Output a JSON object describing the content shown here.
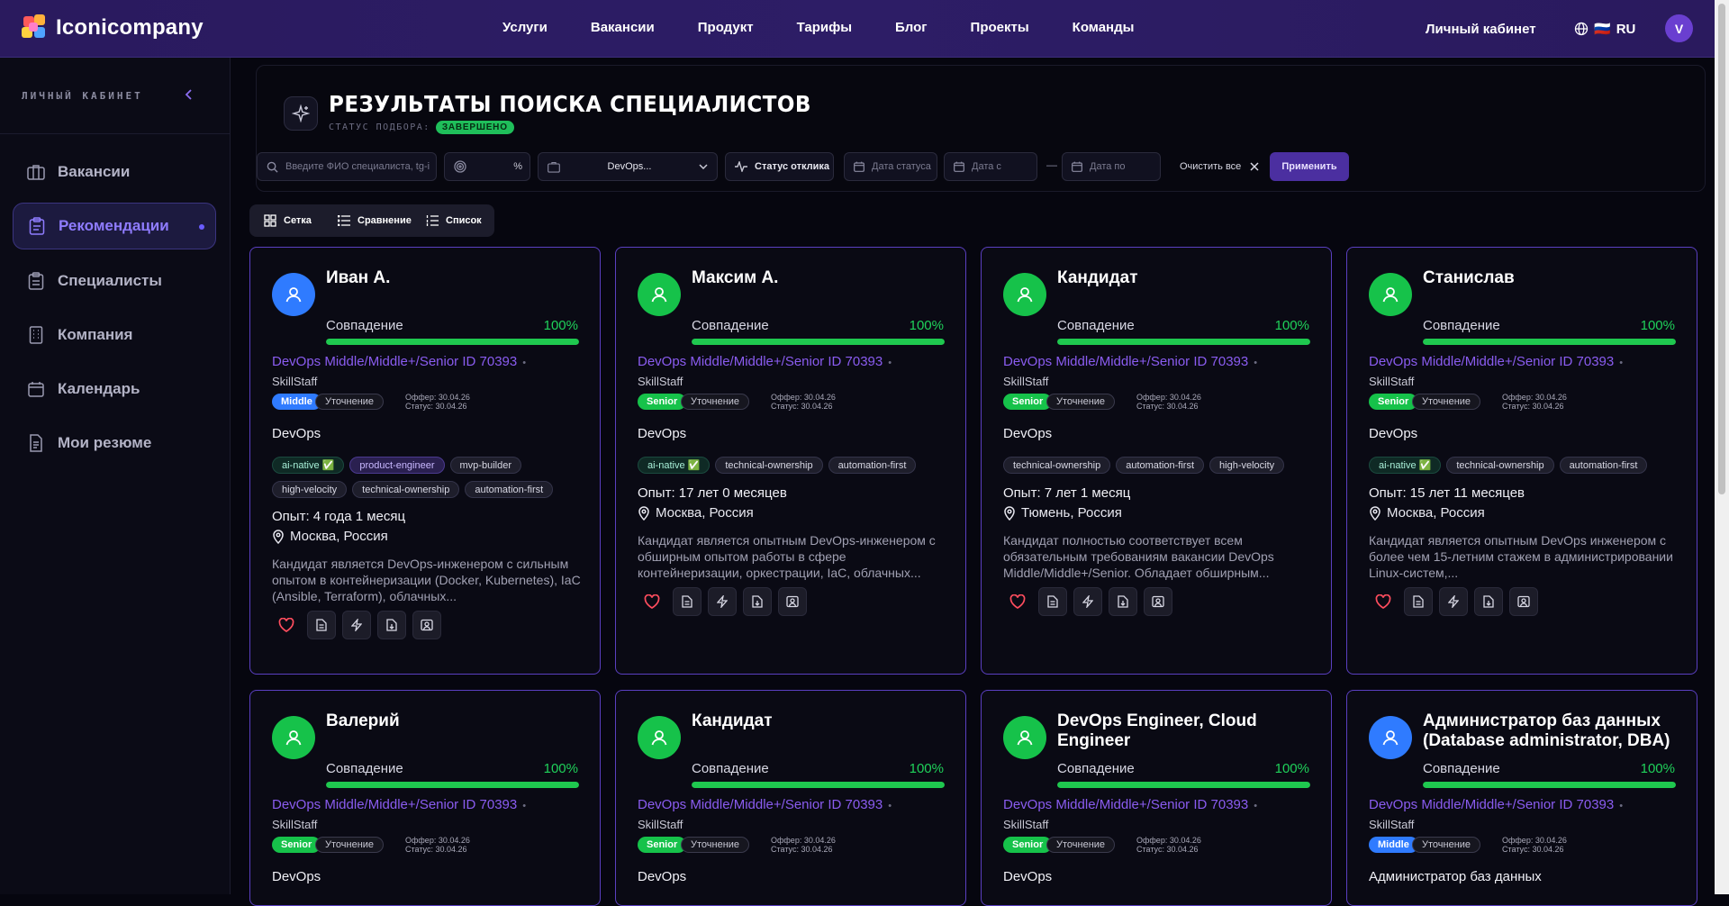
{
  "app": {
    "name": "Iconicompany"
  },
  "nav": [
    "Услуги",
    "Вакансии",
    "Продукт",
    "Тарифы",
    "Блог",
    "Проекты",
    "Команды"
  ],
  "header": {
    "cabinet": "Личный кабинет",
    "lang": "RU",
    "flag": "🇷🇺",
    "avatar_letter": "V"
  },
  "sidebar": {
    "title": "ЛИЧНЫЙ КАБИНЕТ",
    "items": [
      {
        "label": "Вакансии",
        "icon": "briefcase-icon"
      },
      {
        "label": "Рекомендации",
        "icon": "clipboard-icon",
        "active": true
      },
      {
        "label": "Специалисты",
        "icon": "clipboard-list-icon"
      },
      {
        "label": "Компания",
        "icon": "building-icon"
      },
      {
        "label": "Календарь",
        "icon": "calendar-icon"
      },
      {
        "label": "Мои резюме",
        "icon": "document-icon"
      }
    ]
  },
  "page": {
    "title": "РЕЗУЛЬТАТЫ ПОИСКА СПЕЦИАЛИСТОВ",
    "status_label": "СТАТУС ПОДБОРА:",
    "status_value": "ЗАВЕРШЕНО"
  },
  "filters": {
    "search_placeholder": "Введите ФИО специалиста, tg-i",
    "percent_symbol": "%",
    "vacancy_value": "DevOps...",
    "response_status": "Статус отклика",
    "status_date_placeholder": "Дата статуса",
    "date_from_placeholder": "Дата с",
    "dash": "—",
    "date_to_placeholder": "Дата по",
    "clear_all": "Очистить все",
    "apply": "Применить"
  },
  "view_switch": {
    "grid": "Сетка",
    "compare": "Сравнение",
    "list": "Список"
  },
  "colors": {
    "accent": "#8a5cf0",
    "green": "#1fc84f",
    "blue_avatar": "#2f7bff",
    "green_avatar": "#16c24a",
    "middle_badge": "#2f7bff",
    "senior_badge": "#16c24a"
  },
  "card_labels": {
    "match": "Совпадение",
    "clarify": "Уточнение"
  },
  "cards": [
    {
      "name": "Иван А.",
      "avatar_color": "blue",
      "match": "100%",
      "match_fraction": 1.0,
      "vacancy": "DevOps Middle/Middle+/Senior ID 70393",
      "company": "SkillStaff",
      "level": "Middle",
      "offer": "Оффер: 30.04.26",
      "status": "Статус: 30.04.26",
      "role": "DevOps",
      "tags": [
        {
          "label": "ai-native ✅",
          "kind": "ai"
        },
        {
          "label": "product-engineer",
          "kind": "pe"
        },
        {
          "label": "mvp-builder",
          "kind": "plain"
        },
        {
          "label": "high-velocity",
          "kind": "plain"
        },
        {
          "label": "technical-ownership",
          "kind": "plain"
        },
        {
          "label": "automation-first",
          "kind": "plain"
        }
      ],
      "experience": "Опыт: 4 года 1 месяц",
      "location": "Москва, Россия",
      "description": "Кандидат является DevOps-инженером с сильным опытом в контейнеризации (Docker, Kubernetes), IaC (Ansible, Terraform), облачных..."
    },
    {
      "name": "Максим А.",
      "avatar_color": "green",
      "match": "100%",
      "match_fraction": 1.0,
      "vacancy": "DevOps Middle/Middle+/Senior ID 70393",
      "company": "SkillStaff",
      "level": "Senior",
      "offer": "Оффер: 30.04.26",
      "status": "Статус: 30.04.26",
      "role": "DevOps",
      "tags": [
        {
          "label": "ai-native ✅",
          "kind": "ai"
        },
        {
          "label": "technical-ownership",
          "kind": "plain"
        },
        {
          "label": "automation-first",
          "kind": "plain"
        }
      ],
      "experience": "Опыт: 17 лет 0 месяцев",
      "location": "Москва, Россия",
      "description": "Кандидат является опытным DevOps-инженером с обширным опытом работы в сфере контейнеризации, оркестрации, IaC, облачных..."
    },
    {
      "name": "Кандидат",
      "avatar_color": "green",
      "match": "100%",
      "match_fraction": 1.0,
      "vacancy": "DevOps Middle/Middle+/Senior ID 70393",
      "company": "SkillStaff",
      "level": "Senior",
      "offer": "Оффер: 30.04.26",
      "status": "Статус: 30.04.26",
      "role": "DevOps",
      "tags": [
        {
          "label": "technical-ownership",
          "kind": "plain"
        },
        {
          "label": "automation-first",
          "kind": "plain"
        },
        {
          "label": "high-velocity",
          "kind": "plain"
        }
      ],
      "experience": "Опыт: 7 лет 1 месяц",
      "location": "Тюмень, Россия",
      "description": "Кандидат полностью соответствует всем обязательным требованиям вакансии DevOps Middle/Middle+/Senior. Обладает обширным..."
    },
    {
      "name": "Станислав",
      "avatar_color": "green",
      "match": "100%",
      "match_fraction": 1.0,
      "vacancy": "DevOps Middle/Middle+/Senior ID 70393",
      "company": "SkillStaff",
      "level": "Senior",
      "offer": "Оффер: 30.04.26",
      "status": "Статус: 30.04.26",
      "role": "DevOps",
      "tags": [
        {
          "label": "ai-native ✅",
          "kind": "ai"
        },
        {
          "label": "technical-ownership",
          "kind": "plain"
        },
        {
          "label": "automation-first",
          "kind": "plain"
        }
      ],
      "experience": "Опыт: 15 лет 11 месяцев",
      "location": "Москва, Россия",
      "description": "Кандидат является опытным DevOps инженером с более чем 15-летним стажем в администрировании Linux-систем,..."
    },
    {
      "name": "Валерий",
      "avatar_color": "green",
      "match": "100%",
      "match_fraction": 1.0,
      "vacancy": "DevOps Middle/Middle+/Senior ID 70393",
      "company": "SkillStaff",
      "level": "Senior",
      "offer": "Оффер: 30.04.26",
      "status": "Статус: 30.04.26",
      "role": "DevOps"
    },
    {
      "name": "Кандидат",
      "avatar_color": "green",
      "match": "100%",
      "match_fraction": 1.0,
      "vacancy": "DevOps Middle/Middle+/Senior ID 70393",
      "company": "SkillStaff",
      "level": "Senior",
      "offer": "Оффер: 30.04.26",
      "status": "Статус: 30.04.26",
      "role": "DevOps"
    },
    {
      "name": "DevOps Engineer, Cloud Engineer",
      "avatar_color": "green",
      "match": "100%",
      "match_fraction": 1.0,
      "vacancy": "DevOps Middle/Middle+/Senior ID 70393",
      "company": "SkillStaff",
      "level": "Senior",
      "offer": "Оффер: 30.04.26",
      "status": "Статус: 30.04.26",
      "role": "DevOps"
    },
    {
      "name": "Администратор баз данных (Database administrator, DBA)",
      "avatar_color": "blue",
      "match": "100%",
      "match_fraction": 1.0,
      "vacancy": "DevOps Middle/Middle+/Senior ID 70393",
      "company": "SkillStaff",
      "level": "Middle",
      "offer": "Оффер: 30.04.26",
      "status": "Статус: 30.04.26",
      "role": "Администратор баз данных"
    }
  ]
}
